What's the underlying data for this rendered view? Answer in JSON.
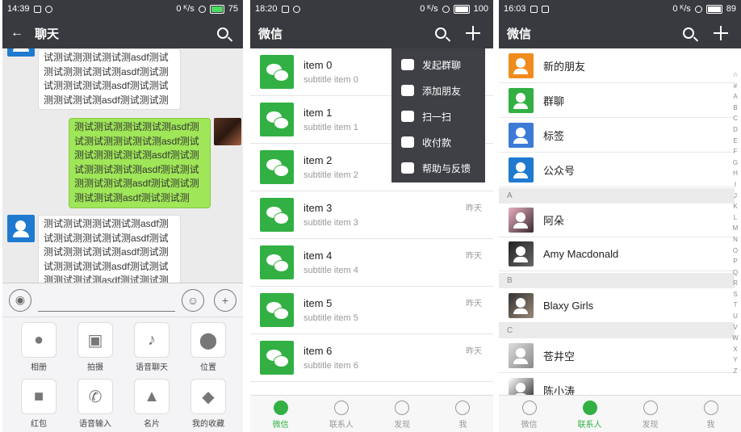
{
  "colors": {
    "accent": "#32b043",
    "bar": "#393a3f",
    "bubble_green": "#9fe658",
    "blue": "#1f7ad0",
    "orange": "#f08c1e"
  },
  "p1": {
    "status": {
      "time": "14:39",
      "net": "0 ᴷ/s",
      "battery": "75"
    },
    "title": "聊天",
    "messages": [
      {
        "text": "试测试测测试测试测asdf测试测试测测试测试测asdf测试测试测测试测试测asdf测试测试测测试测试测asdf测试测试测"
      },
      {
        "text": "测试测试测测试测试测asdf测试测试测测试测试测asdf测试测试测测试测试测asdf测试测试测测试测试测asdf测试测试测测试测试测asdf测试测试测测试测试测asdf测试测试测"
      },
      {
        "text": "测试测试测测试测试测asdf测试测试测测试测试测asdf测试测试测测试测试测asdf测试测试测测试测试测asdf测试测试测测试测试测asdf测试测试测"
      }
    ],
    "panel": [
      "相册",
      "拍摄",
      "语音聊天",
      "位置",
      "红包",
      "语音输入",
      "名片",
      "我的收藏"
    ]
  },
  "p2": {
    "status": {
      "time": "18:20",
      "net": "0 ᴷ/s",
      "battery": "100"
    },
    "title": "微信",
    "items": [
      {
        "title": "item 0",
        "sub": "subtitle item 0",
        "time": ""
      },
      {
        "title": "item 1",
        "sub": "subtitle item 1",
        "time": ""
      },
      {
        "title": "item 2",
        "sub": "subtitle item 2",
        "time": ""
      },
      {
        "title": "item 3",
        "sub": "subtitle item 3",
        "time": "昨天"
      },
      {
        "title": "item 4",
        "sub": "subtitle item 4",
        "time": "昨天"
      },
      {
        "title": "item 5",
        "sub": "subtitle item 5",
        "time": "昨天"
      },
      {
        "title": "item 6",
        "sub": "subtitle item 6",
        "time": "昨天"
      }
    ],
    "menu": [
      "发起群聊",
      "添加朋友",
      "扫一扫",
      "收付款",
      "帮助与反馈"
    ],
    "tabs": [
      "微信",
      "联系人",
      "发现",
      "我"
    ]
  },
  "p3": {
    "status": {
      "time": "16:03",
      "net": "0 ᴷ/s",
      "battery": "89"
    },
    "title": "微信",
    "top": [
      {
        "name": "新的朋友",
        "color": "#f08c1e"
      },
      {
        "name": "群聊",
        "color": "#32b043"
      },
      {
        "name": "标签",
        "color": "#3d7ad6"
      },
      {
        "name": "公众号",
        "color": "#1f7ad0"
      }
    ],
    "sections": [
      {
        "letter": "A",
        "names": [
          "阿朵",
          "Amy Macdonald"
        ]
      },
      {
        "letter": "B",
        "names": [
          "Blaxy Girls"
        ]
      },
      {
        "letter": "C",
        "names": [
          "苍井空",
          "陈小涛"
        ]
      }
    ],
    "index": [
      "☆",
      "#",
      "A",
      "B",
      "C",
      "D",
      "E",
      "F",
      "G",
      "H",
      "I",
      "J",
      "K",
      "L",
      "M",
      "N",
      "O",
      "P",
      "Q",
      "R",
      "S",
      "T",
      "U",
      "V",
      "W",
      "X",
      "Y",
      "Z"
    ],
    "tabs": [
      "微信",
      "联系人",
      "发现",
      "我"
    ]
  }
}
